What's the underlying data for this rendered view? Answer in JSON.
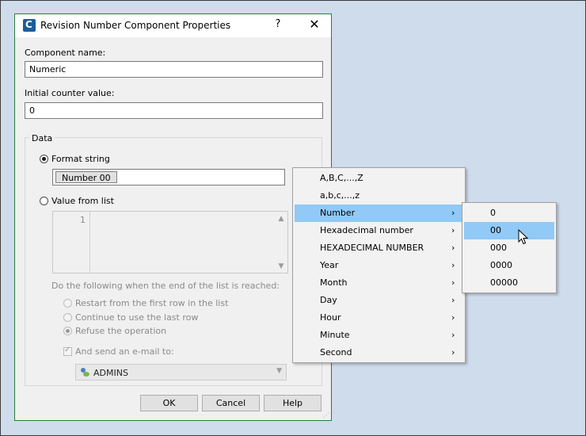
{
  "dialog": {
    "title": "Revision Number Component Properties",
    "help_glyph": "?",
    "close_glyph": "✕",
    "component_name_label": "Component name:",
    "component_name_value": "Numeric",
    "initial_counter_label": "Initial counter value:",
    "initial_counter_value": "0",
    "data_group_title": "Data",
    "format_string_label": "Format string",
    "format_token": "Number 00",
    "value_from_list_label": "Value from list",
    "list_line_number": "1",
    "end_of_list_label": "Do the following when the end of the list is reached:",
    "options": [
      "Restart from the first row in the list",
      "Continue to use the last row",
      "Refuse the operation"
    ],
    "send_email_label": "And send an e-mail to:",
    "email_recipient": "ADMINS",
    "buttons": {
      "ok": "OK",
      "cancel": "Cancel",
      "help": "Help"
    }
  },
  "menu": {
    "items": [
      {
        "label": "A,B,C,...,Z",
        "arrow": ""
      },
      {
        "label": "a,b,c,...,z",
        "arrow": ""
      },
      {
        "label": "Number",
        "arrow": "›"
      },
      {
        "label": "Hexadecimal number",
        "arrow": "›"
      },
      {
        "label": "HEXADECIMAL NUMBER",
        "arrow": "›"
      },
      {
        "label": "Year",
        "arrow": "›"
      },
      {
        "label": "Month",
        "arrow": "›"
      },
      {
        "label": "Day",
        "arrow": "›"
      },
      {
        "label": "Hour",
        "arrow": "›"
      },
      {
        "label": "Minute",
        "arrow": "›"
      },
      {
        "label": "Second",
        "arrow": "›"
      }
    ],
    "highlighted": "Number"
  },
  "submenu": {
    "items": [
      "0",
      "00",
      "000",
      "0000",
      "00000"
    ],
    "highlighted": "00"
  },
  "colors": {
    "highlight": "#91c9f7",
    "dialog_border": "#2a7e3b",
    "background": "#cfdcec"
  },
  "icons": [
    "app-icon",
    "help-icon",
    "close-icon",
    "chevron-right-icon",
    "group-icon",
    "mouse-pointer-icon"
  ]
}
